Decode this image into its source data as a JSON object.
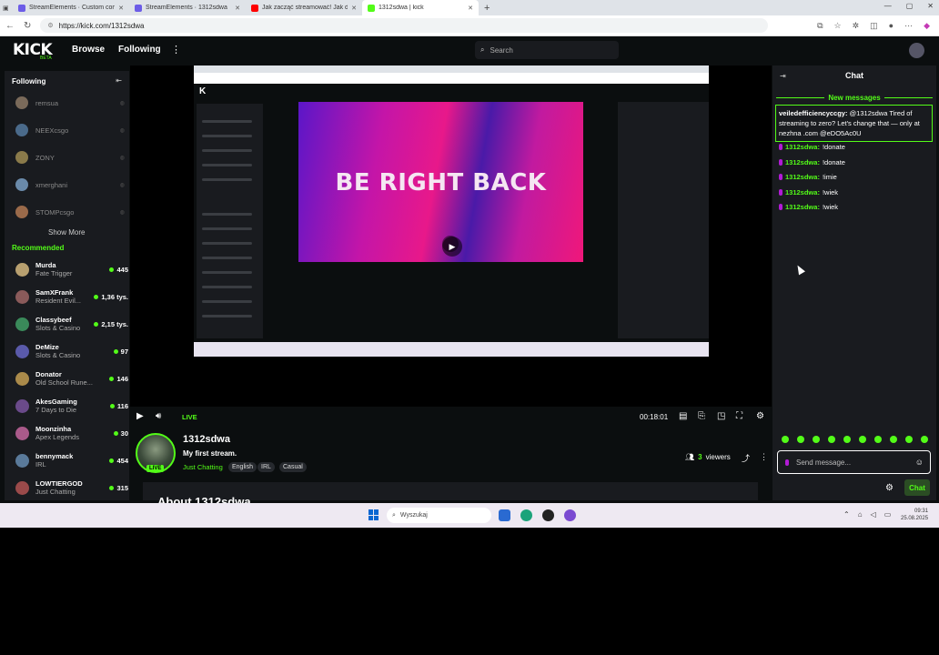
{
  "browser": {
    "tabs": [
      {
        "label": "StreamElements · Custom comm",
        "color": "#6c5ce7"
      },
      {
        "label": "StreamElements · 1312sdwa",
        "color": "#6c5ce7"
      },
      {
        "label": "Jak zacząć streamować! Jak doda",
        "color": "#ff0000"
      },
      {
        "label": "1312sdwa | kick",
        "color": "#53fc18"
      }
    ],
    "url": "https://kick.com/1312sdwa"
  },
  "header": {
    "logo": "KICK",
    "logo_badge": "BETA",
    "nav": [
      "Browse",
      "Following"
    ],
    "search_placeholder": "Search"
  },
  "sidebar": {
    "following_title": "Following",
    "following": [
      {
        "name": "remsua",
        "color": "#7a6a5a"
      },
      {
        "name": "NEEXcsgo",
        "color": "#4a6a8a"
      },
      {
        "name": "ZONY",
        "color": "#8a7a4a"
      },
      {
        "name": "xmerghani",
        "color": "#6a8aaa"
      },
      {
        "name": "STOMPcsgo",
        "color": "#9a6a4a"
      }
    ],
    "show_more": "Show More",
    "recommended_title": "Recommended",
    "recommended": [
      {
        "name": "Murda",
        "category": "Fate Trigger",
        "viewers": "445",
        "color": "#b8a070"
      },
      {
        "name": "SamXFrank",
        "category": "Resident Evil...",
        "viewers": "1,36 tys.",
        "color": "#8a5a5a"
      },
      {
        "name": "Classybeef",
        "category": "Slots & Casino",
        "viewers": "2,15 tys.",
        "color": "#3a8a5a"
      },
      {
        "name": "DeMize",
        "category": "Slots & Casino",
        "viewers": "97",
        "color": "#5a5aaa"
      },
      {
        "name": "Donator",
        "category": "Old School Rune...",
        "viewers": "146",
        "color": "#aa8a4a"
      },
      {
        "name": "AkesGaming",
        "category": "7 Days to Die",
        "viewers": "116",
        "color": "#6a4a8a"
      },
      {
        "name": "Moonzinha",
        "category": "Apex Legends",
        "viewers": "30",
        "color": "#aa5a8a"
      },
      {
        "name": "bennymack",
        "category": "IRL",
        "viewers": "454",
        "color": "#5a7a9a"
      },
      {
        "name": "LOWTIERGOD",
        "category": "Just Chatting",
        "viewers": "315",
        "color": "#9a4a4a"
      }
    ]
  },
  "video": {
    "overlay_text": "BE RIGHT BACK",
    "live_label": "LIVE",
    "time": "00:18:01"
  },
  "stream": {
    "channel": "1312sdwa",
    "title": "My first stream.",
    "category": "Just Chatting",
    "tags": [
      "English",
      "IRL",
      "Casual"
    ],
    "avatar_live": "LIVE",
    "viewers": "3",
    "viewers_label": "viewers",
    "about_title": "About 1312sdwa"
  },
  "chat": {
    "title": "Chat",
    "new_messages": "New messages",
    "highlight_user": "veiledefficiencyccgy:",
    "highlight_text": "@1312sdwa Tired of streaming to zero? Let's change that — only at nezhna .com @eDO5Ac0U",
    "messages": [
      {
        "user": "1312sdwa:",
        "text": "!donate"
      },
      {
        "user": "1312sdwa:",
        "text": "!donate"
      },
      {
        "user": "1312sdwa:",
        "text": "!imie"
      },
      {
        "user": "1312sdwa:",
        "text": "!wiek"
      },
      {
        "user": "1312sdwa:",
        "text": "!wiek"
      }
    ],
    "input_placeholder": "Send message...",
    "send_label": "Chat"
  },
  "taskbar": {
    "search_placeholder": "Wyszukaj",
    "time": "09:31",
    "date": "25.08.2025"
  }
}
